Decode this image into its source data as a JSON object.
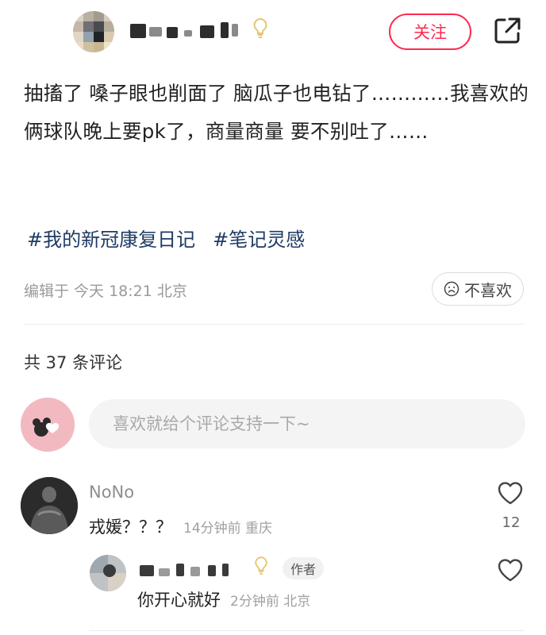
{
  "header": {
    "follow_label": "关注",
    "share_icon": "share-out-icon",
    "bulb_icon": "lightbulb-icon"
  },
  "post": {
    "text": "抽搐了 嗓子眼也削面了 脑瓜子也电钻了…………我喜欢的俩球队晚上要pk了，商量商量 要不别吐了……",
    "tags": [
      "#我的新冠康复日记",
      "#笔记灵感"
    ],
    "edit_info": "编辑于 今天 18:21 北京",
    "dislike_label": "不喜欢"
  },
  "comments_section": {
    "count_text": "共 37 条评论",
    "input_placeholder": "喜欢就给个评论支持一下~"
  },
  "comments": [
    {
      "name": "NoNo",
      "text": "戎媛？？？",
      "meta": "14分钟前 重庆",
      "likes": "12"
    }
  ],
  "reply": {
    "badge": "作者",
    "text": "你开心就好",
    "meta": "2分钟前 北京"
  },
  "colors": {
    "accent": "#ff2a4f",
    "tag": "#1f3a64"
  }
}
